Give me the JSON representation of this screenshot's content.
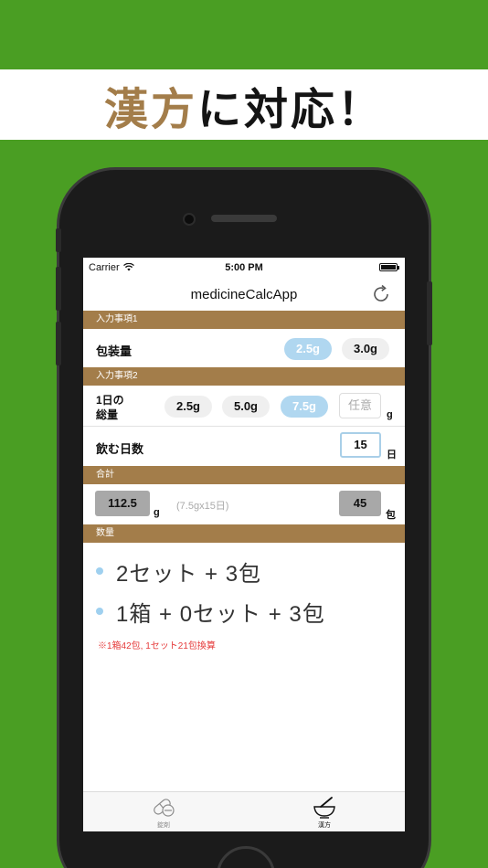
{
  "banner": {
    "accent_text": "漢方",
    "rest_text": "に対応！"
  },
  "status": {
    "carrier": "Carrier",
    "time": "5:00 PM"
  },
  "nav": {
    "title": "medicineCalcApp"
  },
  "sections": {
    "input1": "入力事項1",
    "input2": "入力事項2",
    "total": "合計",
    "quantity": "数量"
  },
  "package": {
    "label": "包装量",
    "options": [
      "2.5g",
      "3.0g"
    ],
    "selected": "2.5g"
  },
  "daily": {
    "label_line1": "1日の",
    "label_line2": "総量",
    "options": [
      "2.5g",
      "5.0g",
      "7.5g"
    ],
    "selected": "7.5g",
    "custom_placeholder": "任意",
    "unit": "g"
  },
  "days": {
    "label": "飲む日数",
    "value": "15",
    "unit": "日"
  },
  "total": {
    "grams": "112.5",
    "grams_unit": "g",
    "formula": "(7.5gx15日)",
    "packs": "45",
    "packs_unit": "包"
  },
  "quantity": {
    "line1": "2セット + 3包",
    "line2": "1箱 + 0セット + 3包",
    "note": "※1箱42包, 1セット21包換算"
  },
  "tabs": [
    {
      "label": "錠剤",
      "icon": "pill-icon",
      "active": false
    },
    {
      "label": "漢方",
      "icon": "mortar-icon",
      "active": true
    }
  ],
  "colors": {
    "background": "#4a9e23",
    "accent": "#a37d4a",
    "selected_pill": "#b0d7f0",
    "note_red": "#e53a3a"
  }
}
